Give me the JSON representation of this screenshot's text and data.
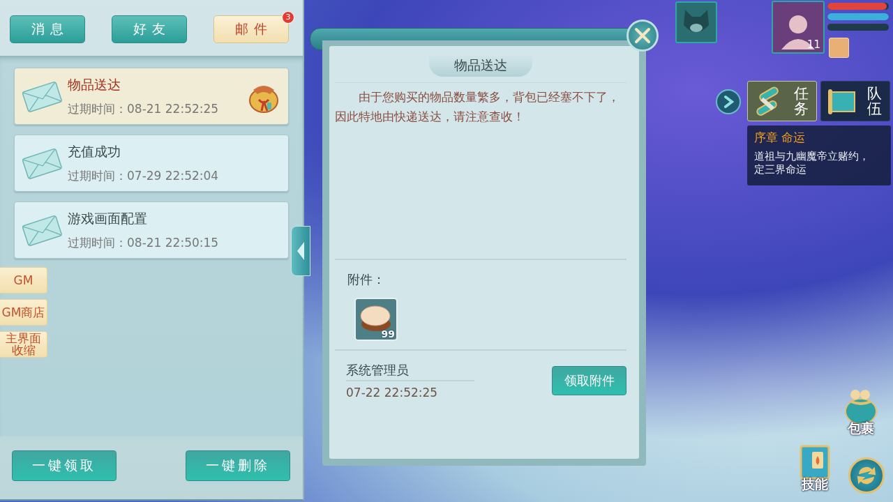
{
  "tabs": [
    {
      "label": "消息",
      "selected": false
    },
    {
      "label": "好友",
      "selected": false
    },
    {
      "label": "邮件",
      "selected": true,
      "badge": "3"
    }
  ],
  "mails": [
    {
      "title": "物品送达",
      "expire": "过期时间：08-21 22:52:25",
      "selected": true,
      "has_attachment": true
    },
    {
      "title": "充值成功",
      "expire": "过期时间：07-29 22:52:04",
      "selected": false,
      "has_attachment": false
    },
    {
      "title": "游戏画面配置",
      "expire": "过期时间：08-21 22:50:15",
      "selected": false,
      "has_attachment": false
    }
  ],
  "side_buttons": [
    "GM",
    "GM商店",
    "主界面收缩"
  ],
  "bulk_buttons": [
    "一键领取",
    "一键删除"
  ],
  "detail": {
    "title": "物品送达",
    "body": "由于您购买的物品数量繁多，背包已经塞不下了，因此特地由快递送达，请注意查收！",
    "attachments_label": "附件：",
    "attachments": [
      {
        "count": "99"
      }
    ],
    "sender": "系统管理员",
    "date": "07-22 22:52:25",
    "claim_button": "领取附件"
  },
  "hud": {
    "player_level": "11",
    "bars": [
      {
        "kind": "health",
        "level": 0.97
      },
      {
        "kind": "mana",
        "level": 1
      },
      {
        "kind": "experience",
        "level": 0
      }
    ]
  },
  "quest_tabs": [
    {
      "label": "任务",
      "selected": true
    },
    {
      "label": "队伍",
      "selected": false
    }
  ],
  "quest": {
    "title": "序章 命运",
    "description": "道祖与九幽魔帝立赌约，定三界命运"
  },
  "shortcuts": [
    {
      "kind": "bag",
      "label": "包裹"
    },
    {
      "kind": "skills",
      "label": "技能"
    }
  ]
}
